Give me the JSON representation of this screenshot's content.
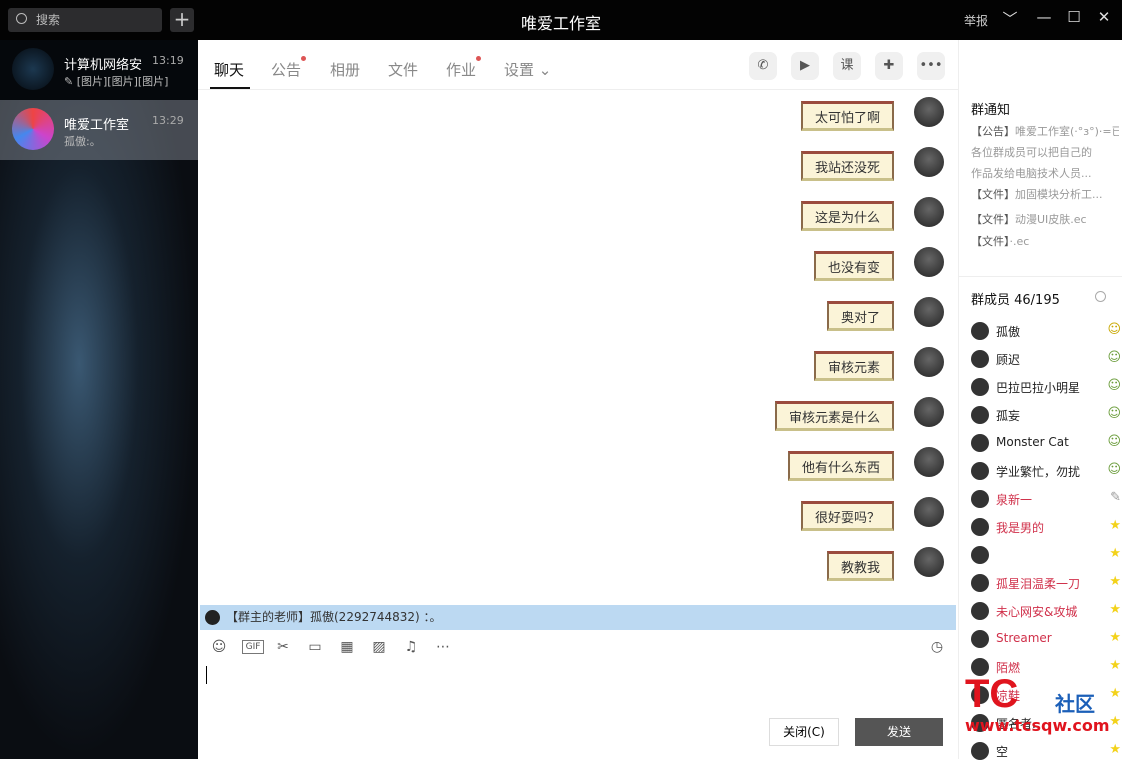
{
  "window": {
    "title": "唯爱工作室",
    "report": "举报",
    "dropdown": "﹀",
    "minimize": "—",
    "maximize": "☐",
    "close": "✕"
  },
  "sidebar": {
    "search_placeholder": "搜索",
    "add": "+",
    "conversations": [
      {
        "name": "计算机网络安",
        "time": "13:19",
        "preview": "✎ [图片][图片][图片]"
      },
      {
        "name": "唯爱工作室",
        "time": "13:29",
        "preview": "孤傲:。"
      }
    ]
  },
  "tabs": [
    {
      "label": "聊天",
      "dot": false
    },
    {
      "label": "公告",
      "dot": true
    },
    {
      "label": "相册",
      "dot": false
    },
    {
      "label": "文件",
      "dot": false
    },
    {
      "label": "作业",
      "dot": true
    },
    {
      "label": "设置 ⌄",
      "dot": false
    }
  ],
  "toolbar_icons": [
    "phone-icon",
    "video-icon",
    "class-icon",
    "add-app-icon",
    "more-icon"
  ],
  "toolbar_glyphs": [
    "✆",
    "▶",
    "课",
    "✚",
    "•••"
  ],
  "messages": [
    "太可怕了啊",
    "我站还没死",
    "这是为什么",
    "也没有变",
    "奥对了",
    "审核元素",
    "审核元素是什么",
    "他有什么东西",
    "很好耍吗？",
    "教教我"
  ],
  "notice_bar": "【群主的老师】孤傲(2292744832) ：。",
  "input_tools": [
    "☺",
    "GIF",
    "✂",
    "▭",
    "▦",
    "▨",
    "♫",
    "⋯",
    "◷"
  ],
  "close_button": "关闭(C)",
  "send_button": "发送",
  "group_notice": {
    "title": "群通知",
    "items": [
      {
        "tag": "【公告】",
        "text": "唯爱工作室(·°з°)·=已经在脚本之家入驻了"
      },
      {
        "tag": "",
        "text": "各位群成员可以把自己的"
      },
      {
        "tag": "",
        "text": "作品发给电脑技术人员..."
      },
      {
        "tag": "【文件】",
        "text": "加固模块分析工..."
      },
      {
        "tag": "【文件】",
        "text": "动漫UI皮肤.ec"
      },
      {
        "tag": "【文件】",
        "text": "·.ec"
      }
    ]
  },
  "members": {
    "title": "群成员 46/195",
    "list": [
      {
        "name": "孤傲",
        "color": "#222",
        "badge": "owner"
      },
      {
        "name": "顾迟",
        "color": "#222",
        "badge": "admin"
      },
      {
        "name": "巴拉巴拉小明星",
        "color": "#222",
        "badge": "admin"
      },
      {
        "name": "孤妄",
        "color": "#222",
        "badge": "admin"
      },
      {
        "name": "Monster Cat",
        "color": "#222",
        "badge": "admin"
      },
      {
        "name": "学业繁忙，勿扰",
        "color": "#222",
        "badge": "admin"
      },
      {
        "name": "泉新一",
        "color": "#d0304a",
        "badge": "edit"
      },
      {
        "name": "我是男的",
        "color": "#d0304a",
        "badge": "star"
      },
      {
        "name": "",
        "color": "#222",
        "badge": "star"
      },
      {
        "name": "孤星泪温柔一刀",
        "color": "#d0304a",
        "badge": "star"
      },
      {
        "name": "未心网安&攻城",
        "color": "#d0304a",
        "badge": "star"
      },
      {
        "name": "Streamer",
        "color": "#d0304a",
        "badge": "star"
      },
      {
        "name": "陌燃",
        "color": "#d0304a",
        "badge": "star"
      },
      {
        "name": "凉鞋",
        "color": "#d0304a",
        "badge": "star"
      },
      {
        "name": "匿名者.",
        "color": "#222",
        "badge": "star"
      },
      {
        "name": "空",
        "color": "#222",
        "badge": "star"
      }
    ]
  },
  "watermark": {
    "logo": "TC",
    "text": "社区",
    "url": "www.tcsqw.com"
  }
}
